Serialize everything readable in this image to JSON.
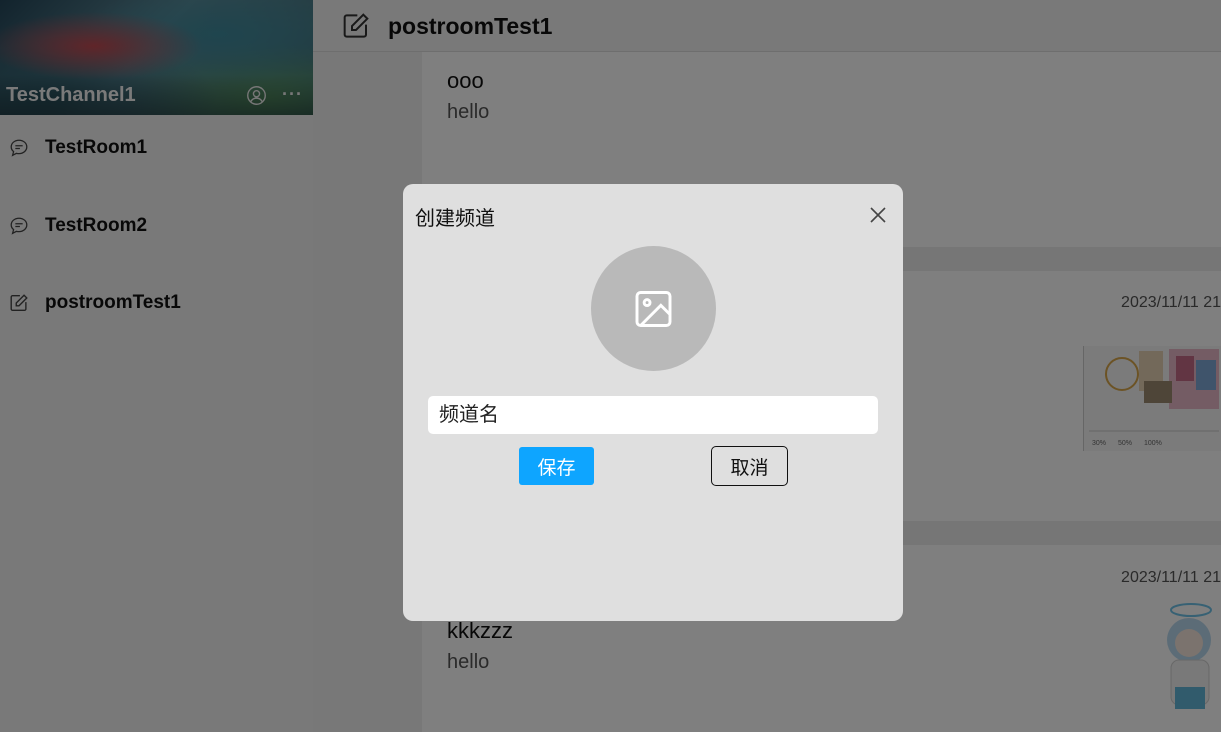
{
  "sidebar": {
    "channel_name": "TestChannel1",
    "banner_icons": [
      "user-circle-icon",
      "more-dots-icon"
    ],
    "more_glyph": "···",
    "rooms": [
      {
        "label": "TestRoom1",
        "icon": "chat-bubble-icon"
      },
      {
        "label": "TestRoom2",
        "icon": "chat-bubble-icon"
      },
      {
        "label": "postroomTest1",
        "icon": "edit-square-icon"
      }
    ]
  },
  "header": {
    "title": "postroomTest1",
    "icon": "edit-square-icon"
  },
  "posts": [
    {
      "title": "ooo",
      "body": "hello",
      "date": ""
    },
    {
      "title": "",
      "body": "",
      "date": "2023/11/11 21"
    },
    {
      "title": "kkkzzz",
      "body": "hello",
      "date": "2023/11/11 21"
    }
  ],
  "modal": {
    "title": "创建频道",
    "avatar_icon": "image-icon",
    "name_placeholder": "频道名",
    "name_value": "",
    "save_label": "保存",
    "cancel_label": "取消",
    "close_icon": "close-icon"
  },
  "colors": {
    "primary_button": "#0ea5ff",
    "modal_background": "#dfdfdf",
    "overlay": "rgba(0,0,0,0.5)"
  }
}
